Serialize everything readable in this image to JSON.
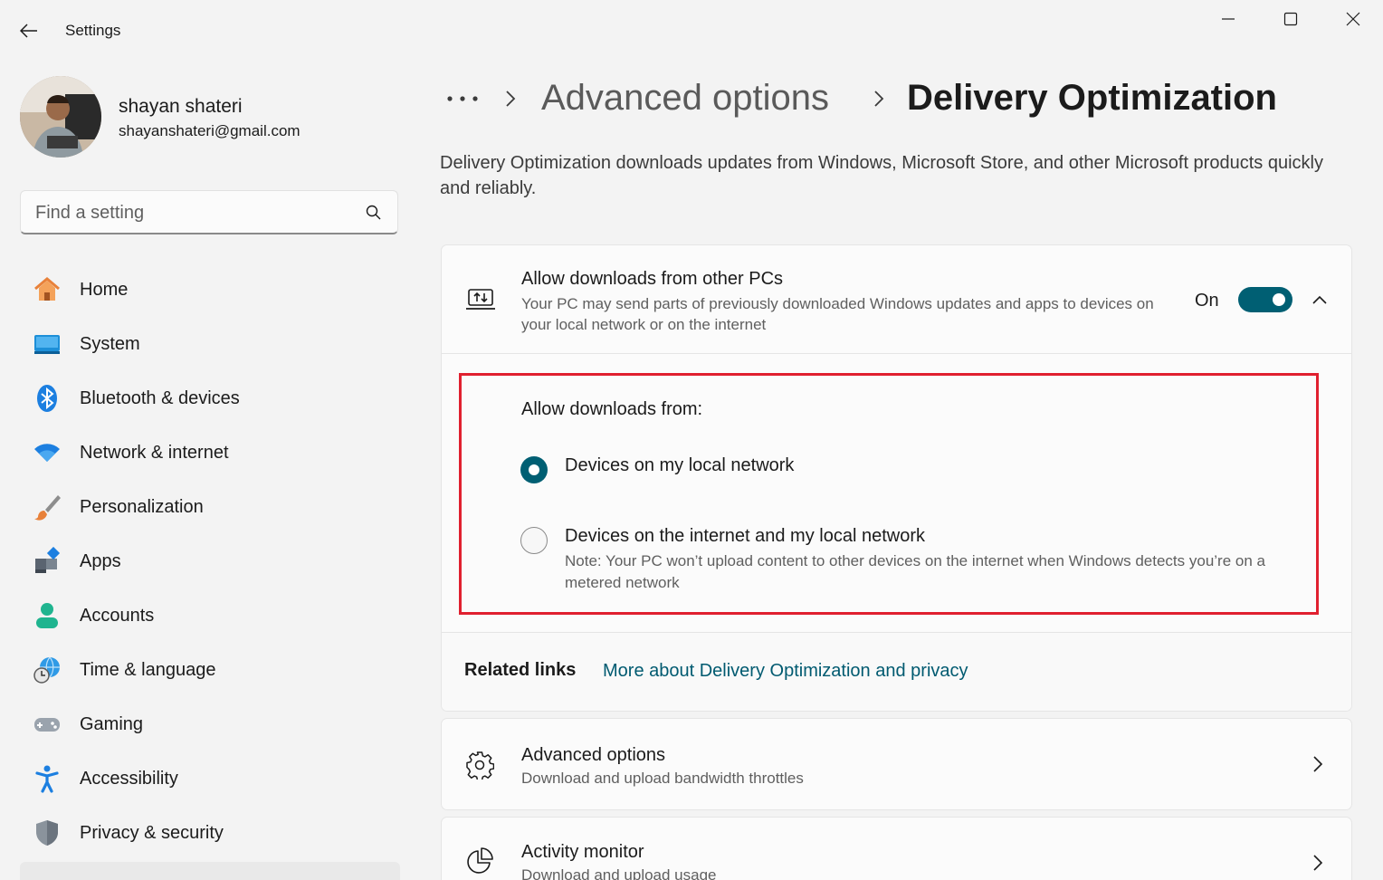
{
  "titlebar": {
    "app_title": "Settings",
    "icons": {
      "back": "back-arrow-icon",
      "minimize": "minimize-icon",
      "maximize": "maximize-icon",
      "close": "close-icon"
    }
  },
  "profile": {
    "name": "shayan shateri",
    "email": "shayanshateri@gmail.com"
  },
  "search": {
    "placeholder": "Find a setting",
    "value": ""
  },
  "sidebar": {
    "items": [
      {
        "label": "Home",
        "icon": "home-icon"
      },
      {
        "label": "System",
        "icon": "system-icon"
      },
      {
        "label": "Bluetooth & devices",
        "icon": "bluetooth-icon"
      },
      {
        "label": "Network & internet",
        "icon": "wifi-icon"
      },
      {
        "label": "Personalization",
        "icon": "brush-icon"
      },
      {
        "label": "Apps",
        "icon": "apps-icon"
      },
      {
        "label": "Accounts",
        "icon": "account-icon"
      },
      {
        "label": "Time & language",
        "icon": "globe-clock-icon"
      },
      {
        "label": "Gaming",
        "icon": "gamepad-icon"
      },
      {
        "label": "Accessibility",
        "icon": "accessibility-icon"
      },
      {
        "label": "Privacy & security",
        "icon": "shield-icon"
      }
    ]
  },
  "breadcrumb": {
    "more": "•••",
    "parent": "Advanced options",
    "current": "Delivery Optimization"
  },
  "description": "Delivery Optimization downloads updates from Windows, Microsoft Store, and other Microsoft products quickly and reliably.",
  "allow_card": {
    "title": "Allow downloads from other PCs",
    "description": "Your PC may send parts of previously downloaded Windows updates and apps to devices on your local network or on the internet",
    "toggle_state_label": "On",
    "toggle_on": true,
    "expanded": true,
    "allow_from_label": "Allow downloads from:",
    "options": [
      {
        "label": "Devices on my local network",
        "selected": true,
        "note": ""
      },
      {
        "label": "Devices on the internet and my local network",
        "selected": false,
        "note": "Note: Your PC won’t upload content to other devices on the internet when Windows detects you’re on a metered network"
      }
    ],
    "highlight_color": "#e0202f",
    "accent_color": "#005f73"
  },
  "related": {
    "title": "Related links",
    "link": "More about Delivery Optimization and privacy"
  },
  "rows": [
    {
      "title": "Advanced options",
      "description": "Download and upload bandwidth throttles",
      "icon": "gear-icon"
    },
    {
      "title": "Activity monitor",
      "description": "Download and upload usage",
      "icon": "pie-chart-icon"
    }
  ]
}
